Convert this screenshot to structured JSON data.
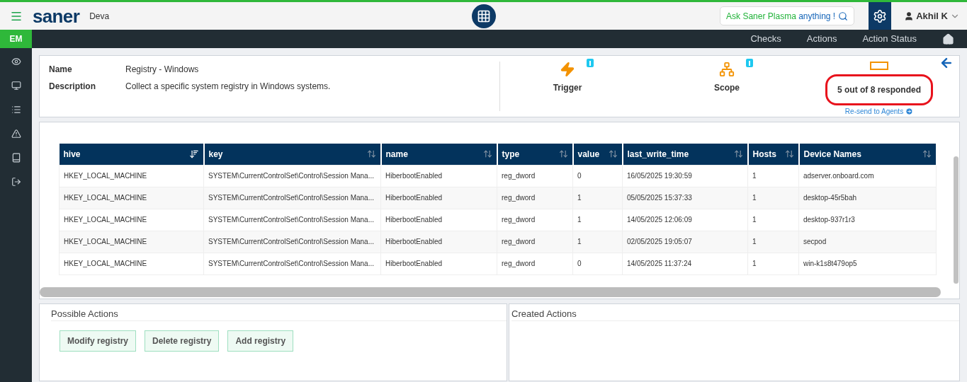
{
  "header": {
    "brand": "saner",
    "org": "Deva",
    "search_prompt": {
      "prefix": "Ask Saner Plasma",
      "suffix": "anything !"
    },
    "user": "Akhil K"
  },
  "nav": {
    "items": [
      "Checks",
      "Actions",
      "Action Status"
    ]
  },
  "sidebar": {
    "badge": "EM"
  },
  "details": {
    "fields": [
      {
        "label": "Name",
        "value": "Registry - Windows"
      },
      {
        "label": "Description",
        "value": "Collect a specific system registry in Windows systems."
      }
    ],
    "trigger": {
      "label": "Trigger"
    },
    "scope": {
      "label": "Scope"
    },
    "responses": {
      "text": "5 out of 8 responded",
      "resend": "Re-send to Agents"
    }
  },
  "table": {
    "columns": [
      {
        "label": "hive",
        "sorted": true
      },
      {
        "label": "key",
        "sorted": false
      },
      {
        "label": "name",
        "sorted": false
      },
      {
        "label": "type",
        "sorted": false
      },
      {
        "label": "value",
        "sorted": false
      },
      {
        "label": "last_write_time",
        "sorted": false
      },
      {
        "label": "Hosts",
        "sorted": false
      },
      {
        "label": "Device Names",
        "sorted": false
      }
    ],
    "rows": [
      [
        "HKEY_LOCAL_MACHINE",
        "SYSTEM\\CurrentControlSet\\Control\\Session Mana...",
        "HiberbootEnabled",
        "reg_dword",
        "0",
        "16/05/2025 19:30:59",
        "1",
        "adserver.onboard.com"
      ],
      [
        "HKEY_LOCAL_MACHINE",
        "SYSTEM\\CurrentControlSet\\Control\\Session Mana...",
        "HiberbootEnabled",
        "reg_dword",
        "1",
        "05/05/2025 15:37:33",
        "1",
        "desktop-45r5bah"
      ],
      [
        "HKEY_LOCAL_MACHINE",
        "SYSTEM\\CurrentControlSet\\Control\\Session Mana...",
        "HiberbootEnabled",
        "reg_dword",
        "1",
        "14/05/2025 12:06:09",
        "1",
        "desktop-937r1r3"
      ],
      [
        "HKEY_LOCAL_MACHINE",
        "SYSTEM\\CurrentControlSet\\Control\\Session Mana...",
        "HiberbootEnabled",
        "reg_dword",
        "1",
        "02/05/2025 19:05:07",
        "1",
        "secpod"
      ],
      [
        "HKEY_LOCAL_MACHINE",
        "SYSTEM\\CurrentControlSet\\Control\\Session Mana...",
        "HiberbootEnabled",
        "reg_dword",
        "0",
        "14/05/2025 11:37:24",
        "1",
        "win-k1s8t479op5"
      ]
    ]
  },
  "possible_actions": {
    "title": "Possible Actions",
    "buttons": [
      "Modify registry",
      "Delete registry",
      "Add registry"
    ]
  },
  "created_actions": {
    "title": "Created Actions"
  }
}
